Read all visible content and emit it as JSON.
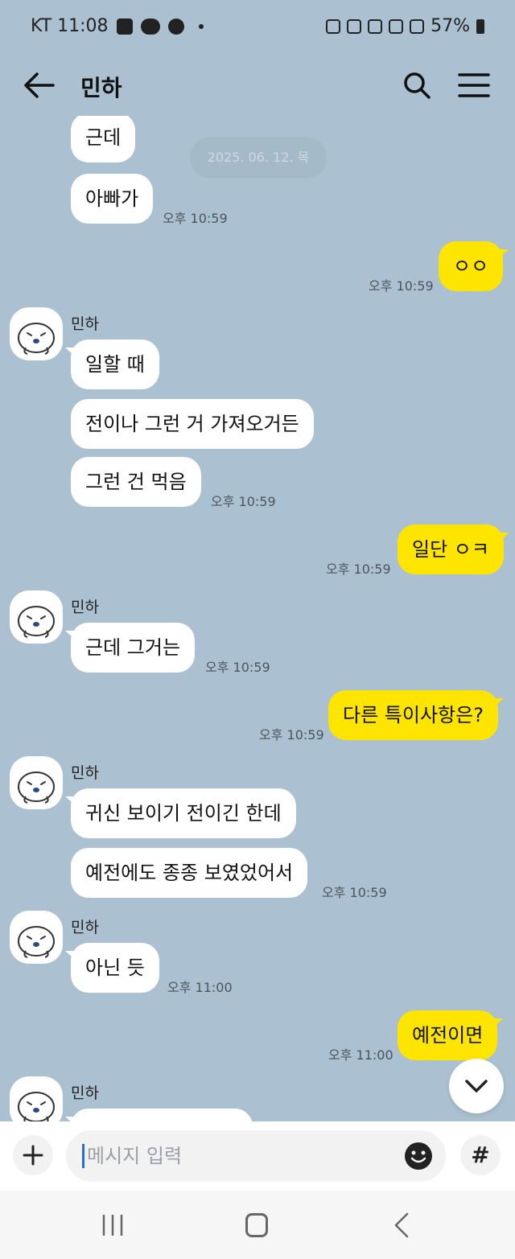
{
  "status_bar": {
    "carrier_time": "KT 11:08",
    "battery": "57%"
  },
  "header": {
    "title": "민하",
    "back_icon": "arrow-left-icon",
    "search_icon": "search-icon",
    "menu_icon": "hamburger-menu-icon"
  },
  "chat": {
    "date_divider": "2025. 06. 12. 목",
    "messages": [
      {
        "text": "근데"
      },
      {
        "text": "아빠가",
        "time": "오후 10:59"
      },
      {
        "text": "ㅇㅇ",
        "time": "오후 10:59"
      },
      {
        "sender": "민하"
      },
      {
        "text": "일할 때"
      },
      {
        "text": "전이나 그런 거 가져오거든"
      },
      {
        "text": "그런 건 먹음",
        "time": "오후 10:59"
      },
      {
        "text": "일단 ㅇㅋ",
        "time": "오후 10:59"
      },
      {
        "sender": "민하"
      },
      {
        "text": "근데 그거는",
        "time": "오후 10:59"
      },
      {
        "text": "다른 특이사항은?",
        "time": "오후 10:59"
      },
      {
        "sender": "민하"
      },
      {
        "text": "귀신 보이기 전이긴 한데"
      },
      {
        "text": "예전에도 종종 보였었어서",
        "time": "오후 10:59"
      },
      {
        "sender": "민하"
      },
      {
        "text": "아닌 듯",
        "time": "오후 11:00"
      },
      {
        "text": "예전이면",
        "time": "오후 11:00"
      },
      {
        "sender": "민하"
      }
    ]
  },
  "input": {
    "placeholder": "메시지 입력",
    "hash_label": "#"
  },
  "colors": {
    "background": "#abc1d1",
    "outgoing_bubble": "#fee500",
    "incoming_bubble": "#ffffff"
  }
}
